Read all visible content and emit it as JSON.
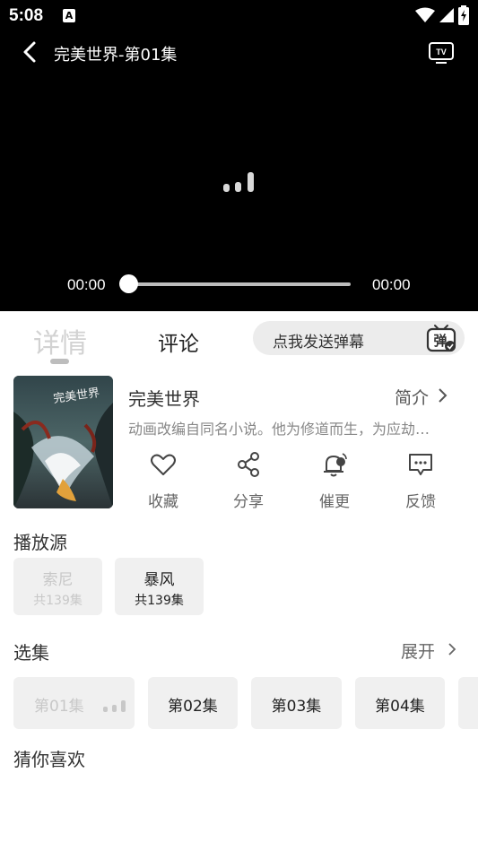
{
  "status_bar": {
    "time": "5:08",
    "notification_letter": "A"
  },
  "header": {
    "title": "完美世界-第01集"
  },
  "player": {
    "current_time": "00:00",
    "total_time": "00:00",
    "progress": 0
  },
  "tabs": {
    "details": "详情",
    "comments": "评论"
  },
  "danmaku": {
    "placeholder": "点我发送弹幕",
    "icon_text": "弹"
  },
  "anime": {
    "name": "完美世界",
    "intro_label": "简介",
    "synopsis": "动画改编自同名小说。他为修道而生，为应劫…",
    "poster_title": "完美世界"
  },
  "actions": [
    {
      "label": "收藏",
      "icon": "heart-icon"
    },
    {
      "label": "分享",
      "icon": "share-icon"
    },
    {
      "label": "催更",
      "icon": "bell-icon"
    },
    {
      "label": "反馈",
      "icon": "feedback-icon"
    }
  ],
  "sources": {
    "title": "播放源",
    "items": [
      {
        "name": "索尼",
        "count": "共139集",
        "selected": false
      },
      {
        "name": "暴风",
        "count": "共139集",
        "selected": true
      }
    ]
  },
  "episodes": {
    "title": "选集",
    "expand_label": "展开",
    "items": [
      "第01集",
      "第02集",
      "第03集",
      "第04集"
    ]
  },
  "recommend": {
    "title": "猜你喜欢"
  },
  "colors": {
    "player_bg": "#000000",
    "card_bg": "#f0f0f0",
    "muted": "#c8c8c8"
  }
}
